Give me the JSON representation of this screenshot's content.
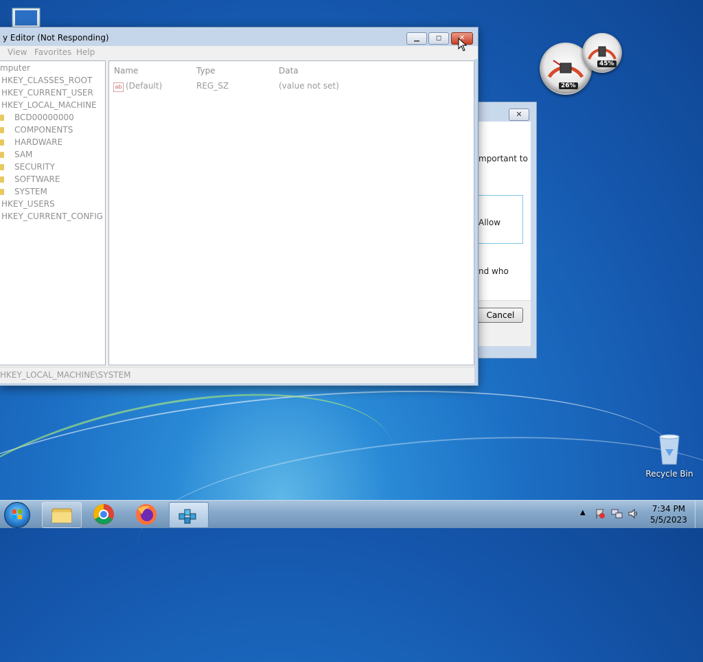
{
  "desktop": {
    "recycle_bin_label": "Recycle Bin"
  },
  "gadget": {
    "cpu_value": "26%",
    "memory_value": "45%"
  },
  "regedit": {
    "title": "y Editor (Not Responding)",
    "menu": [
      "View",
      "Favorites",
      "Help"
    ],
    "tree": {
      "root": "mputer",
      "hives": [
        "HKEY_CLASSES_ROOT",
        "HKEY_CURRENT_USER",
        "HKEY_LOCAL_MACHINE"
      ],
      "hklm_children": [
        "BCD00000000",
        "COMPONENTS",
        "HARDWARE",
        "SAM",
        "SECURITY",
        "SOFTWARE",
        "SYSTEM"
      ],
      "hives_after": [
        "HKEY_USERS",
        "HKEY_CURRENT_CONFIG"
      ]
    },
    "columns": [
      "Name",
      "Type",
      "Data"
    ],
    "rows": [
      {
        "name": "(Default)",
        "type": "REG_SZ",
        "data": "(value not set)"
      }
    ],
    "status_path": "HKEY_LOCAL_MACHINE\\SYSTEM"
  },
  "dialog": {
    "text1": "mportant to",
    "text2": "Allow",
    "text3": "nd who",
    "cancel_label": "Cancel"
  },
  "taskbar": {
    "time": "7:34 PM",
    "date": "5/5/2023"
  }
}
